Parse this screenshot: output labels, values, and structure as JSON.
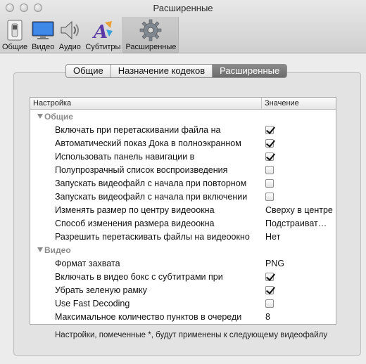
{
  "window": {
    "title": "Расширенные"
  },
  "toolbar": {
    "items": [
      {
        "label": "Общие",
        "icon": "switch-icon"
      },
      {
        "label": "Видео",
        "icon": "monitor-icon"
      },
      {
        "label": "Аудио",
        "icon": "speaker-icon"
      },
      {
        "label": "Субтитры",
        "icon": "subtitles-icon"
      },
      {
        "label": "Расширенные",
        "icon": "gear-icon",
        "selected": true
      }
    ]
  },
  "tabs": [
    {
      "label": "Общие"
    },
    {
      "label": "Назначение кодеков"
    },
    {
      "label": "Расширенные",
      "active": true
    }
  ],
  "table": {
    "headers": {
      "name": "Настройка",
      "value": "Значение"
    },
    "groups": [
      {
        "title": "Общие",
        "rows": [
          {
            "name": "Включать при перетаскивании файла на",
            "type": "checkbox",
            "checked": true
          },
          {
            "name": "Автоматический показ Дока в полноэкранном",
            "type": "checkbox",
            "checked": true
          },
          {
            "name": "Использовать панель навигации в",
            "type": "checkbox",
            "checked": true
          },
          {
            "name": "Полупрозрачный список воспроизведения",
            "type": "checkbox",
            "checked": false
          },
          {
            "name": "Запускать видеофайл с начала при повторном",
            "type": "checkbox",
            "checked": false
          },
          {
            "name": "Запускать видеофайл с начала при включении",
            "type": "checkbox",
            "checked": false
          },
          {
            "name": "Изменять размер по центру видеоокна",
            "type": "text",
            "value": "Сверху в центре"
          },
          {
            "name": "Способ изменения размера видеоокна",
            "type": "text",
            "value": "Подстраиват…"
          },
          {
            "name": "Разрешить перетаскивать файлы на видеоокно",
            "type": "text",
            "value": "Нет"
          }
        ]
      },
      {
        "title": "Видео",
        "rows": [
          {
            "name": "Формат захвата",
            "type": "text",
            "value": "PNG"
          },
          {
            "name": "Включать в видео бокс с субтитрами при",
            "type": "checkbox",
            "checked": true
          },
          {
            "name": "Убрать зеленую рамку",
            "type": "checkbox",
            "checked": true
          },
          {
            "name": "Use Fast Decoding",
            "type": "checkbox",
            "checked": false
          },
          {
            "name": "Максимальное количество пунктов в очереди",
            "type": "text",
            "value": "8"
          }
        ]
      }
    ]
  },
  "footnote": "Настройки, помеченные *, будут применены к следующему видеофайлу"
}
